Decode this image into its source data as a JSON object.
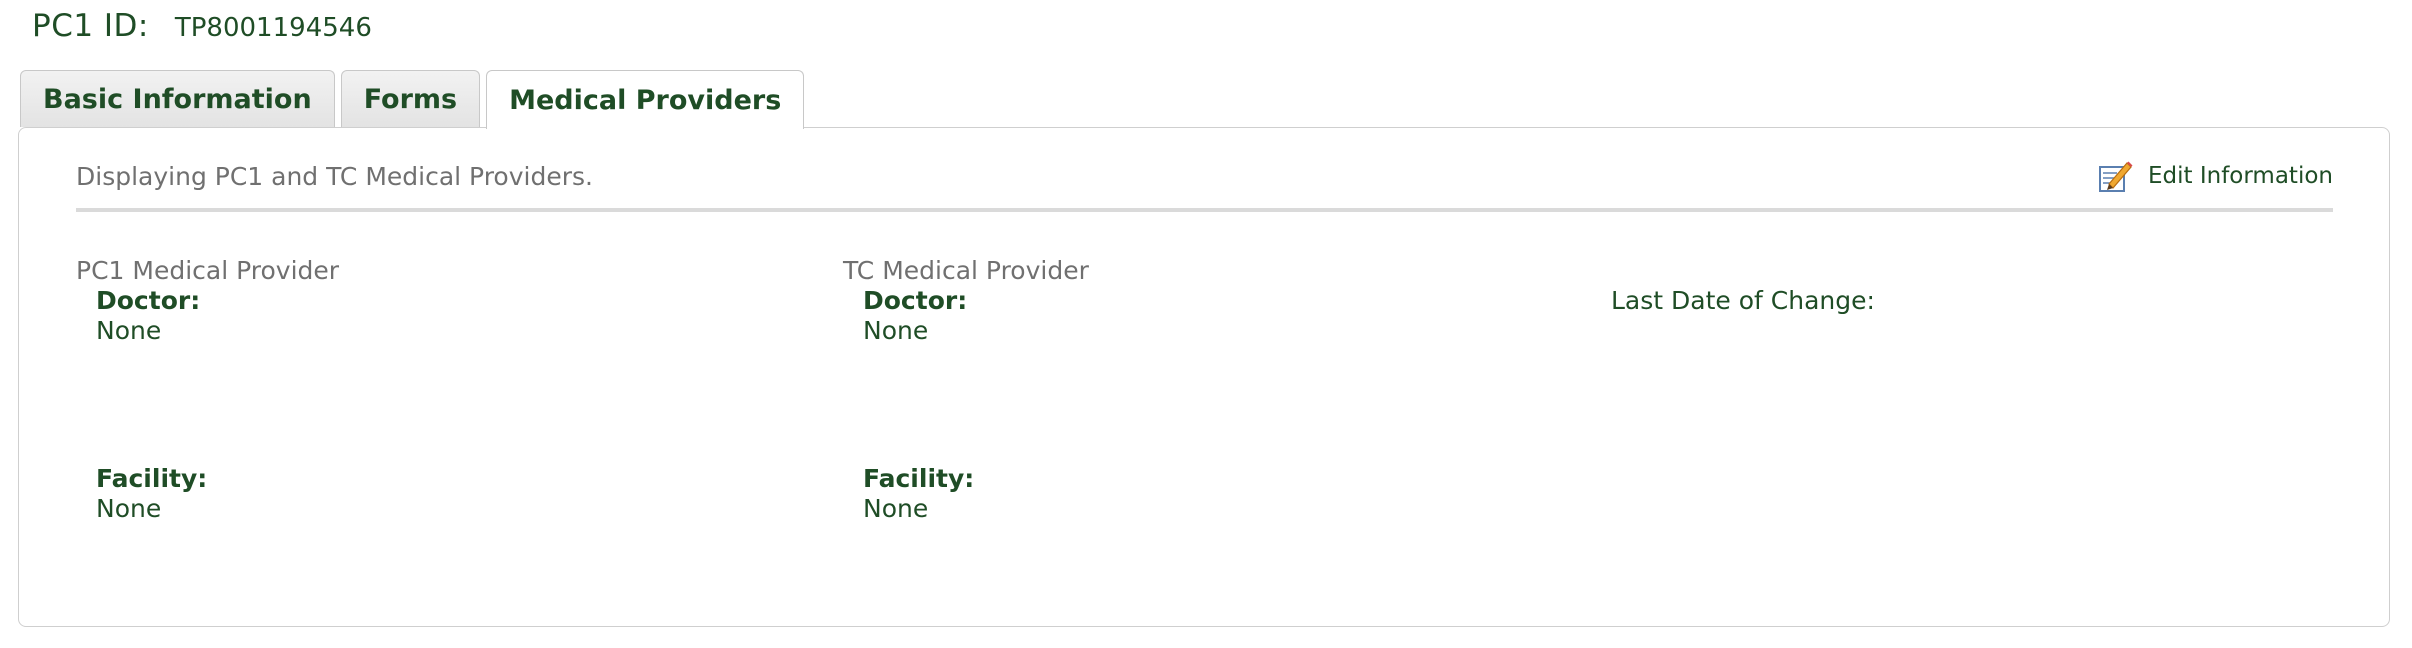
{
  "header": {
    "label": "PC1 ID:",
    "value": "TP8001194546"
  },
  "tabs": [
    {
      "label": "Basic Information",
      "active": false
    },
    {
      "label": "Forms",
      "active": false
    },
    {
      "label": "Medical Providers",
      "active": true
    }
  ],
  "panel": {
    "description": "Displaying PC1 and TC Medical Providers.",
    "edit_label": "Edit Information",
    "edit_icon": "edit-pencil-icon"
  },
  "pc1_provider": {
    "title": "PC1 Medical Provider",
    "doctor_label": "Doctor:",
    "doctor_value": "None",
    "facility_label": "Facility:",
    "facility_value": "None"
  },
  "tc_provider": {
    "title": "TC Medical Provider",
    "doctor_label": "Doctor:",
    "doctor_value": "None",
    "facility_label": "Facility:",
    "facility_value": "None"
  },
  "last_change": {
    "label": "Last Date of Change:"
  },
  "colors": {
    "text_green": "#1f4d26",
    "muted_gray": "#707070",
    "border": "#cfcfcf"
  }
}
